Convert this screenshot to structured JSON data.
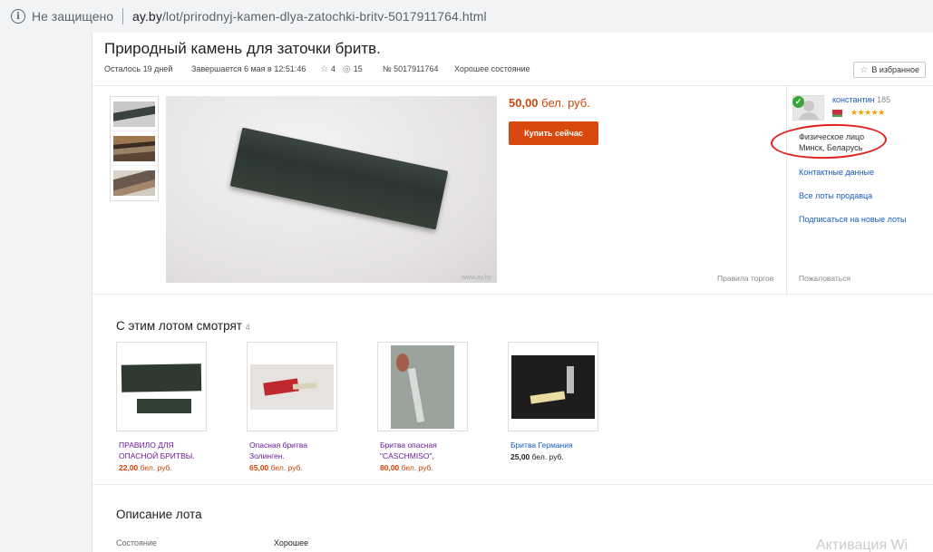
{
  "browser": {
    "security_label": "Не защищено",
    "url_domain": "ay.by",
    "url_path": "/lot/prirodnyj-kamen-dlya-zatochki-britv-5017911764.html"
  },
  "lot": {
    "title": "Природный камень для заточки бритв.",
    "remaining": "Осталось 19 дней",
    "ends": "Завершается 6 мая в 12:51:46",
    "watchers": "4",
    "views": "15",
    "number": "№ 5017911764",
    "condition": "Хорошее состояние",
    "favorite_label": "В избранное",
    "price_value": "50,00",
    "price_currency": "бел. руб.",
    "buy_label": "Купить сейчас",
    "rules_label": "Правила торгов",
    "watermark": "www.ay.by"
  },
  "seller": {
    "name": "константин",
    "score": "185",
    "stars": "★★★★★",
    "type": "Физическое лицо",
    "location": "Минск, Беларусь",
    "links": {
      "contacts": "Контактные данные",
      "all_lots": "Все лоты продавца",
      "subscribe": "Подписаться на новые лоты"
    },
    "report_label": "Пожаловаться"
  },
  "related": {
    "title": "С этим лотом смотрят",
    "count": "4",
    "items": [
      {
        "name_line1": "ПРАВИЛО ДЛЯ",
        "name_line2": "ОПАСНОЙ БРИТВЫ.",
        "price": "22,00",
        "currency": "бел. руб."
      },
      {
        "name_line1": "Опасная бритва",
        "name_line2": "Золинген.",
        "price": "65,00",
        "currency": "бел. руб."
      },
      {
        "name_line1": "Бритва опасная",
        "name_line2": "\"CASCHMISO\",",
        "price": "80,00",
        "currency": "бел. руб."
      },
      {
        "name_line1": "Бритва Германия",
        "name_line2": "",
        "price": "25,00",
        "currency": "бел. руб."
      }
    ]
  },
  "description": {
    "title": "Описание лота",
    "label": "Состояние",
    "value": "Хорошее"
  },
  "os_overlay": "Активация Wi",
  "icons": {
    "info": "info-icon",
    "star": "star-icon",
    "eye": "eye-icon",
    "verified": "check-icon"
  },
  "colors": {
    "accent": "#d9490f",
    "price": "#d1460b",
    "link": "#1a5bbf",
    "annotation": "#e0201b"
  }
}
